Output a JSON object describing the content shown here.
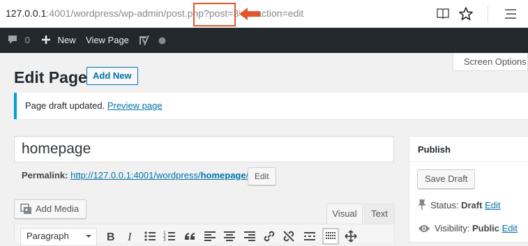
{
  "browser": {
    "url_host": "127.0.0.1",
    "url_rest": ":4001/wordpress/wp-admin/post.php?post=353&action=edit",
    "reader_icon": "reader-view-icon",
    "favorite_icon": "star-icon",
    "menu_icon": "hamburger-menu-icon",
    "highlight_color": "#e0572f"
  },
  "adminbar": {
    "comments_count": "0",
    "new_label": "New",
    "view_page_label": "View Page",
    "yoast_icon": "yoast-icon",
    "status_dot_icon": "seo-status-dot-icon"
  },
  "screen_options": "Screen Options",
  "page": {
    "title": "Edit Page",
    "add_new": "Add New"
  },
  "notice": {
    "text": "Page draft updated.",
    "link": "Preview page",
    "accent": "#00a0d2"
  },
  "editor": {
    "title_value": "homepage",
    "permalink_label": "Permalink:",
    "permalink_base": "http://127.0.0.1:4001/wordpress/",
    "permalink_slug": "homepage",
    "permalink_trailing": "/",
    "edit_button": "Edit",
    "add_media": "Add Media",
    "tab_visual": "Visual",
    "tab_text": "Text",
    "format_value": "Paragraph",
    "toolbar_icons": [
      "bold-icon",
      "italic-icon",
      "bullet-list-icon",
      "numbered-list-icon",
      "blockquote-icon",
      "align-left-icon",
      "align-center-icon",
      "align-right-icon",
      "insert-link-icon",
      "remove-link-icon",
      "read-more-icon",
      "toolbar-toggle-icon",
      "fullscreen-icon"
    ]
  },
  "publish": {
    "heading": "Publish",
    "save_draft": "Save Draft",
    "status_label": "Status:",
    "status_value": "Draft",
    "status_edit": "Edit",
    "visibility_label": "Visibility:",
    "visibility_value": "Public",
    "visibility_edit": "Edit"
  }
}
